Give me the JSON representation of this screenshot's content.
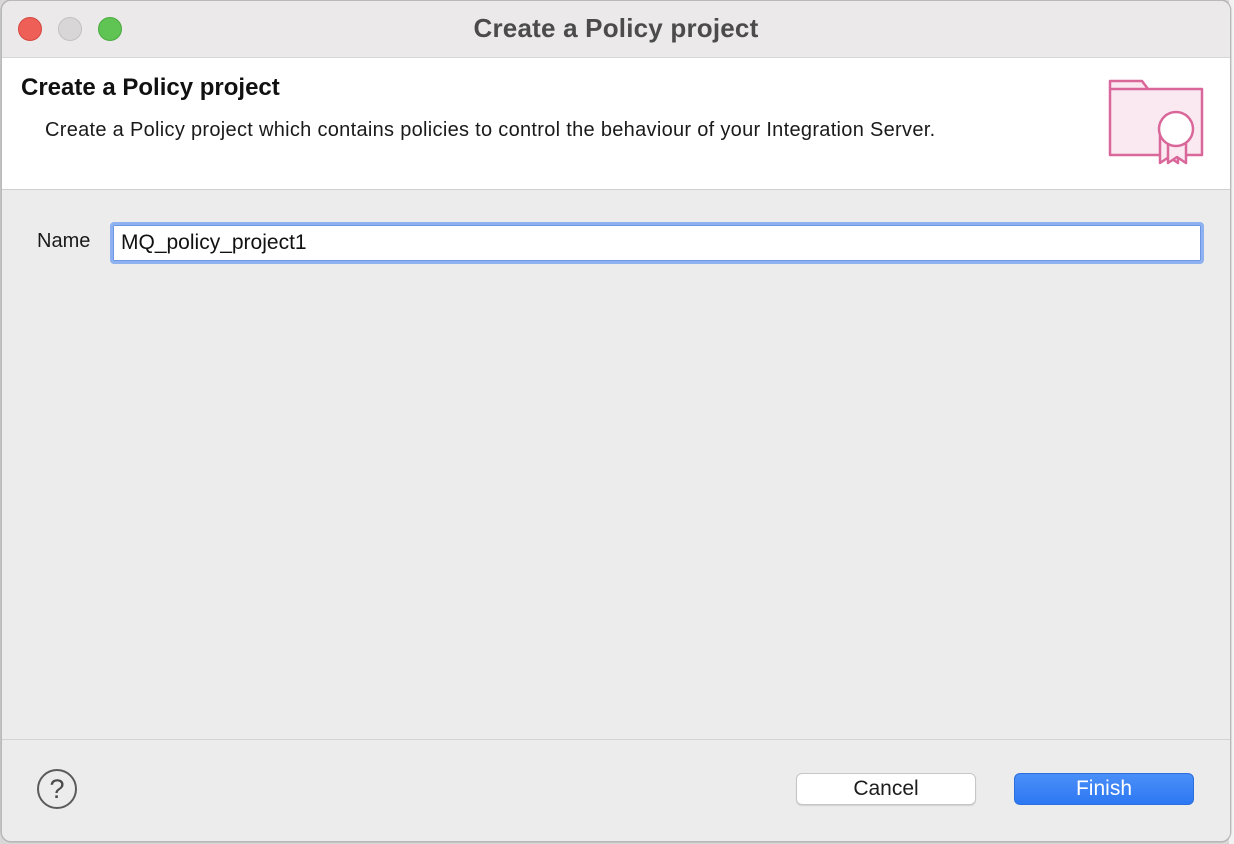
{
  "window": {
    "title": "Create a Policy project"
  },
  "banner": {
    "title": "Create a Policy project",
    "description": "Create a Policy project which contains policies to control the behaviour of your Integration Server.",
    "icon": "policy-folder-certificate-icon"
  },
  "form": {
    "name_label": "Name",
    "name_value": "MQ_policy_project1"
  },
  "footer": {
    "help_symbol": "?",
    "cancel_label": "Cancel",
    "finish_label": "Finish"
  },
  "colors": {
    "accent": "#2f7cf6",
    "icon_pink": "#d9679a",
    "close": "#ee5f57",
    "maximize": "#5fc453"
  }
}
